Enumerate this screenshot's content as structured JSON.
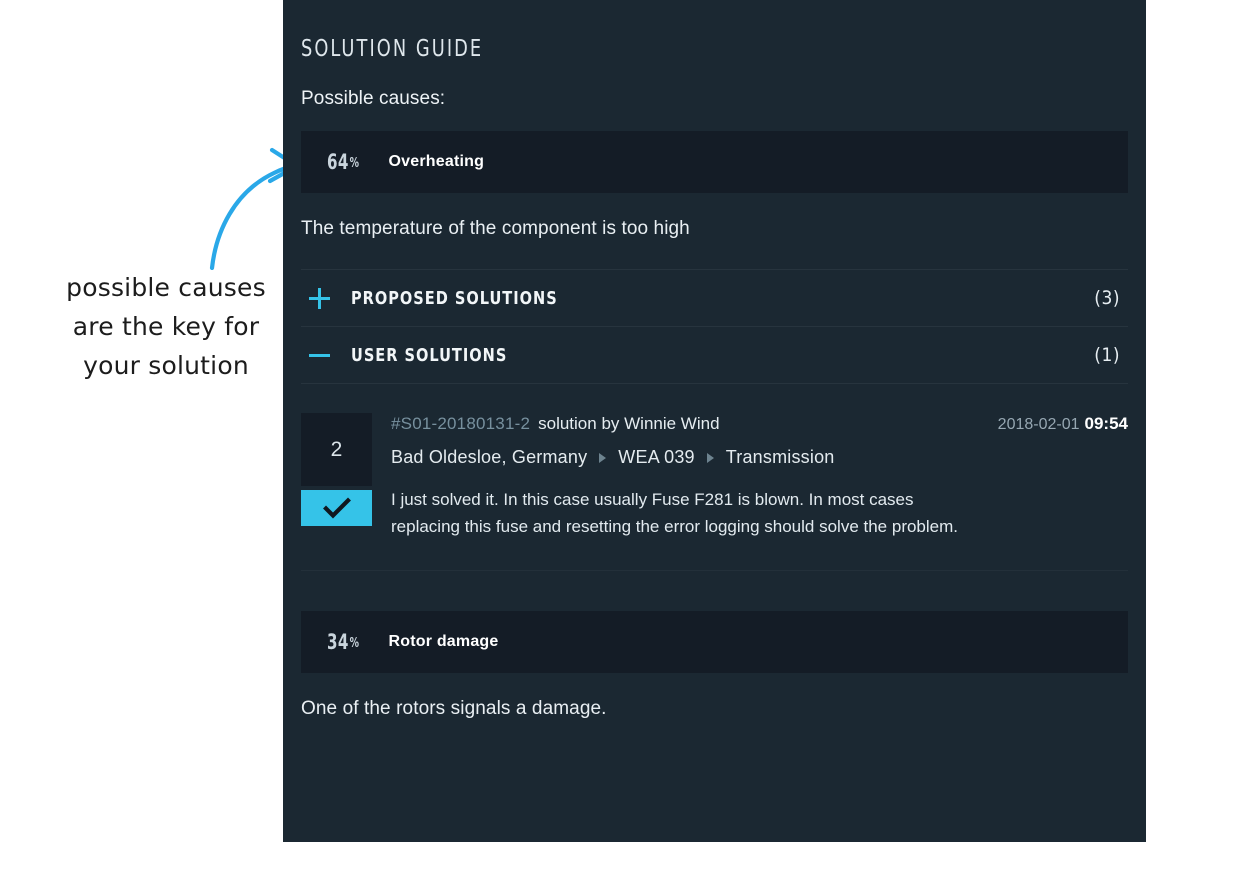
{
  "annotation": {
    "lines": [
      "possible causes",
      "are the key for",
      "your solution"
    ],
    "arrow_color": "#2aa8e8"
  },
  "panel": {
    "title": "SOLUTION GUIDE",
    "possible_causes_label": "Possible causes:",
    "background_color": "#1b2832",
    "band_color": "#141c26",
    "accent_color": "#35c3e8"
  },
  "causes": [
    {
      "percent": "64",
      "percent_sign": "%",
      "name": "Overheating",
      "description": "The temperature of the component is too high"
    },
    {
      "percent": "34",
      "percent_sign": "%",
      "name": "Rotor damage",
      "description": "One of the rotors signals a damage."
    }
  ],
  "accordion": [
    {
      "icon": "plus-icon",
      "label": "PROPOSED SOLUTIONS",
      "count": "(3)"
    },
    {
      "icon": "minus-icon",
      "label": "USER SOLUTIONS",
      "count": "(1)"
    }
  ],
  "user_solution": {
    "votes": "2",
    "accepted_icon": "check-icon",
    "id": "#S01-20180131-2",
    "byline": "solution by Winnie Wind",
    "date": "2018-02-01",
    "time": "09:54",
    "breadcrumb": [
      "Bad Oldesloe,  Germany",
      "WEA 039",
      "Transmission"
    ],
    "text": "I just solved it. In this case usually Fuse F281 is blown. In most cases replacing this fuse and resetting the error logging should solve the problem."
  }
}
